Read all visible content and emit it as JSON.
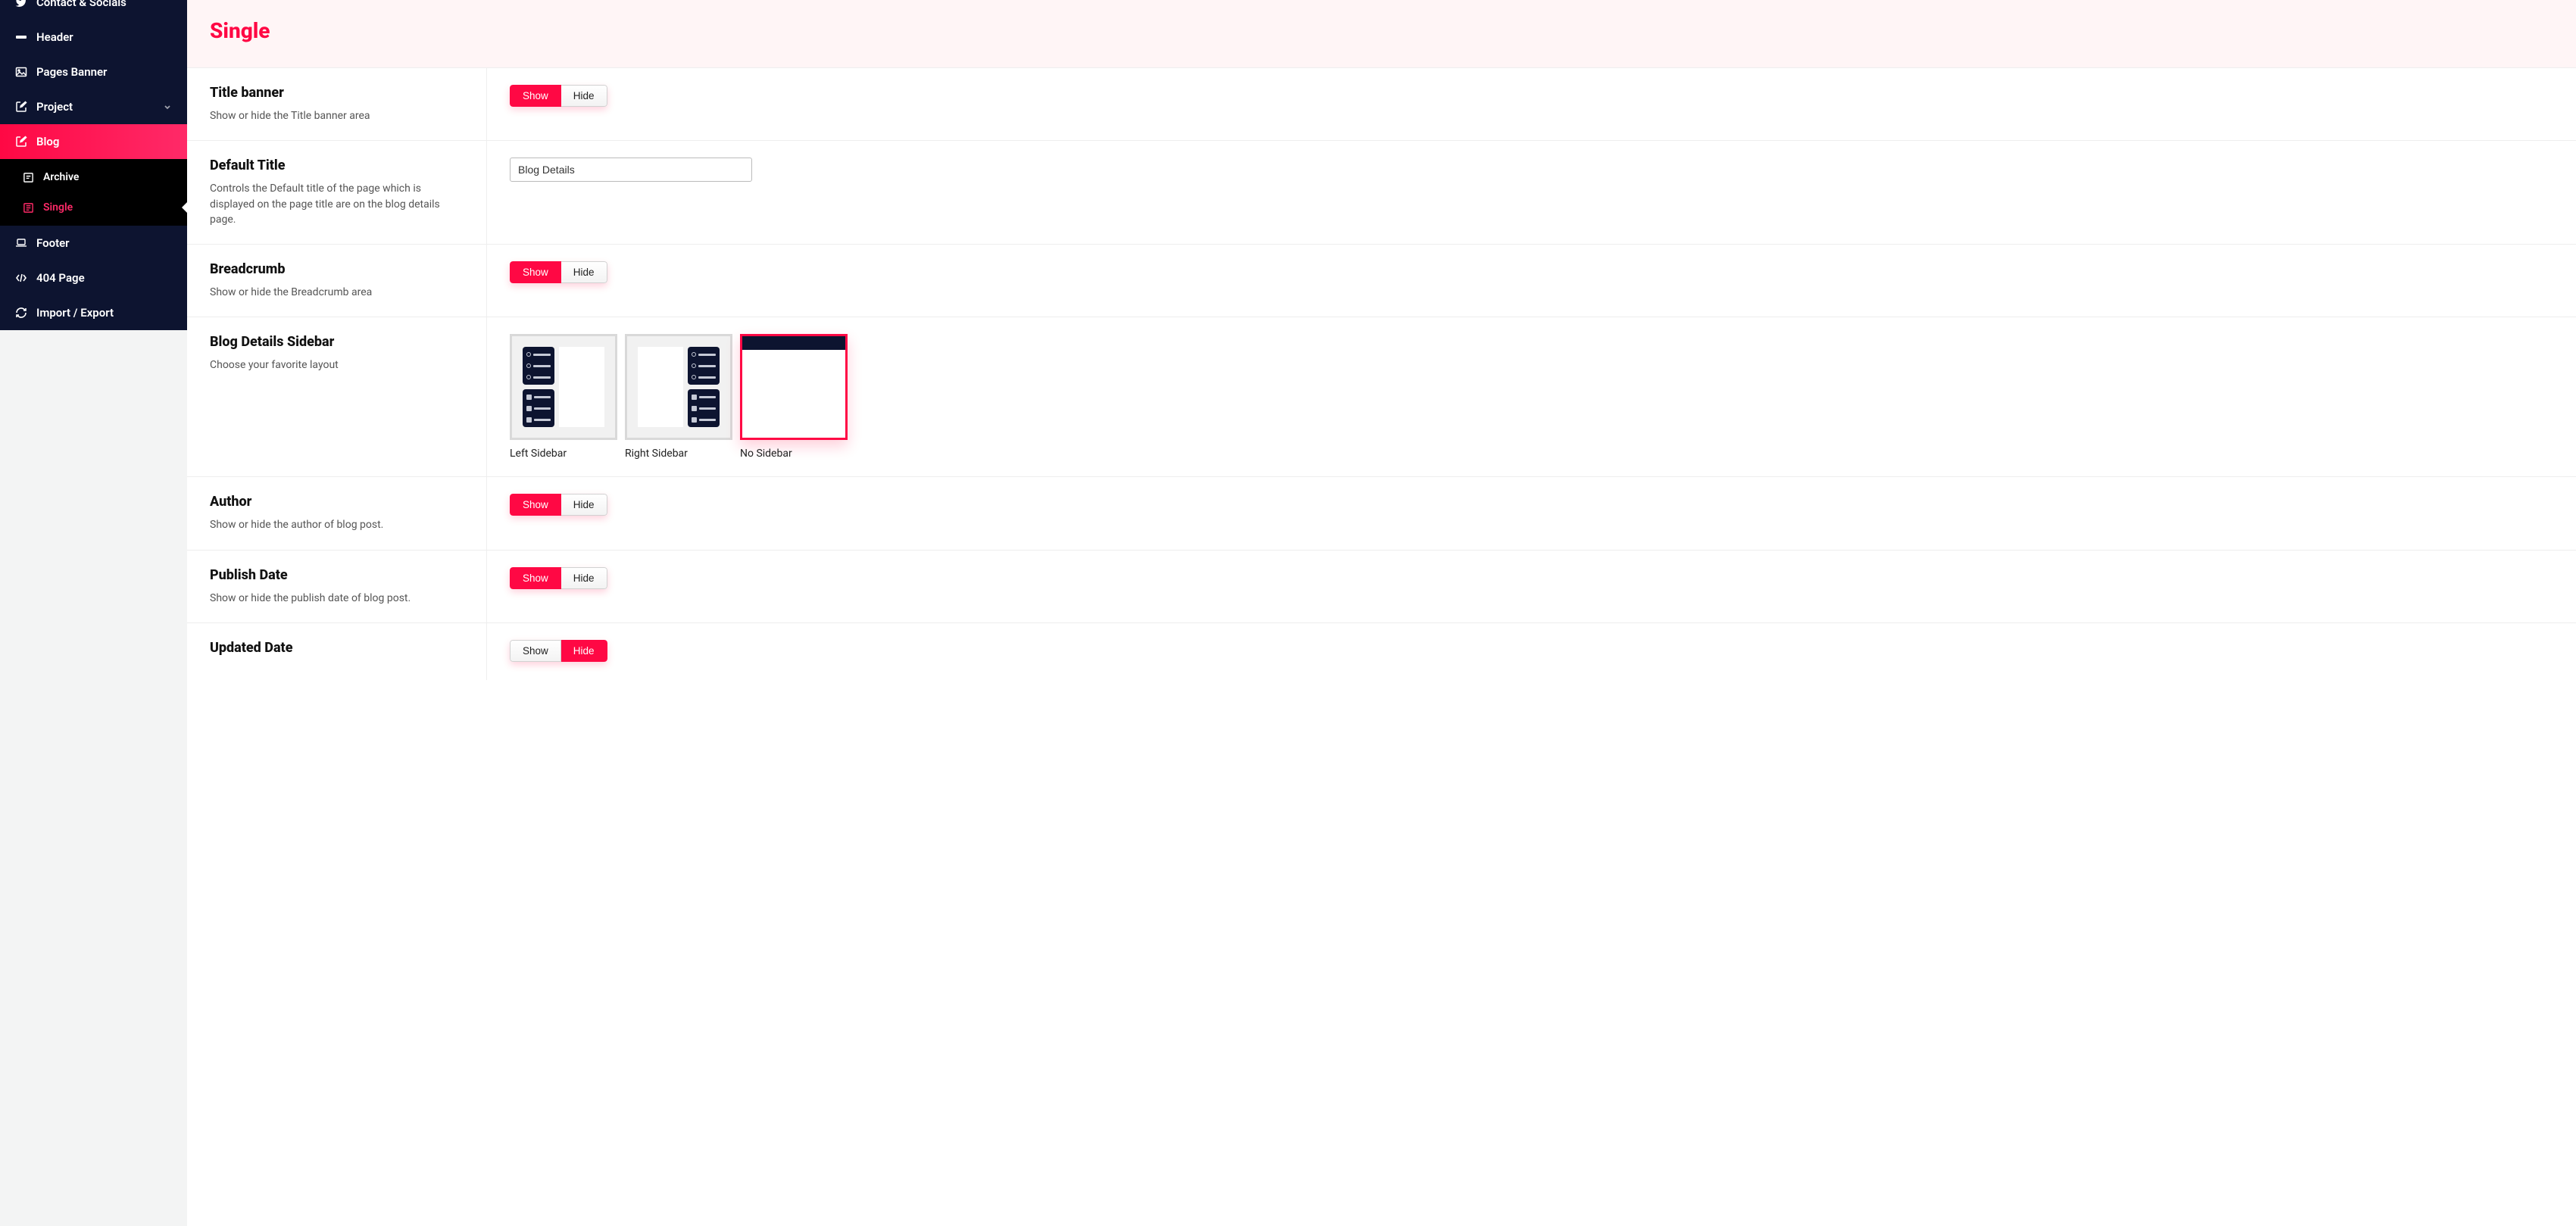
{
  "sidebar": {
    "items": [
      {
        "label": "Contact & Socials"
      },
      {
        "label": "Header"
      },
      {
        "label": "Pages Banner"
      },
      {
        "label": "Project"
      },
      {
        "label": "Blog"
      },
      {
        "label": "Footer"
      },
      {
        "label": "404 Page"
      },
      {
        "label": "Import / Export"
      }
    ],
    "blog_sub": [
      {
        "label": "Archive"
      },
      {
        "label": "Single"
      }
    ]
  },
  "page": {
    "title": "Single"
  },
  "toggle_labels": {
    "show": "Show",
    "hide": "Hide"
  },
  "fields": {
    "title_banner": {
      "title": "Title banner",
      "desc": "Show or hide the Title banner area",
      "selected": "show"
    },
    "default_title": {
      "title": "Default Title",
      "desc": "Controls the Default title of the page which is displayed on the page title are on the blog details page.",
      "value": "Blog Details"
    },
    "breadcrumb": {
      "title": "Breadcrumb",
      "desc": "Show or hide the Breadcrumb area",
      "selected": "show"
    },
    "sidebar_layout": {
      "title": "Blog Details Sidebar",
      "desc": "Choose your favorite layout",
      "options": [
        {
          "label": "Left Sidebar"
        },
        {
          "label": "Right Sidebar"
        },
        {
          "label": "No Sidebar"
        }
      ],
      "selected": 2
    },
    "author": {
      "title": "Author",
      "desc": "Show or hide the author of blog post.",
      "selected": "show"
    },
    "publish_date": {
      "title": "Publish Date",
      "desc": "Show or hide the publish date of blog post.",
      "selected": "show"
    },
    "updated_date": {
      "title": "Updated Date",
      "desc": "",
      "selected": "hide"
    }
  }
}
